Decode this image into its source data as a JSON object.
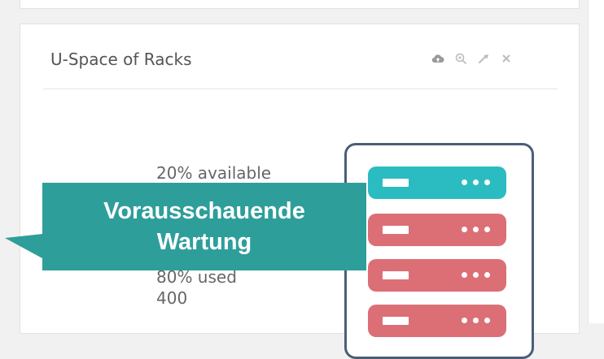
{
  "widget": {
    "title": "U-Space of Racks",
    "tools": [
      {
        "icon": "cloud-upload-icon"
      },
      {
        "icon": "zoom-icon"
      },
      {
        "icon": "wrench-icon"
      },
      {
        "icon": "close-icon"
      }
    ]
  },
  "stats": {
    "available": "20% available",
    "used": "80% used",
    "total": "400"
  },
  "rack": {
    "units": [
      {
        "status": "available",
        "color": "#2bbcc1"
      },
      {
        "status": "used",
        "color": "#dc6f76"
      },
      {
        "status": "used",
        "color": "#dc6f76"
      },
      {
        "status": "used",
        "color": "#dc6f76"
      }
    ]
  },
  "callout": {
    "lines": [
      "Vorausschauende",
      "Wartung"
    ],
    "color": "#2e9e9b"
  },
  "colors": {
    "page_bg": "#f1f1f1",
    "card_bg": "#ffffff",
    "rack_frame": "#4b5e78",
    "available": "#2bbcc1",
    "used": "#dc6f76"
  }
}
